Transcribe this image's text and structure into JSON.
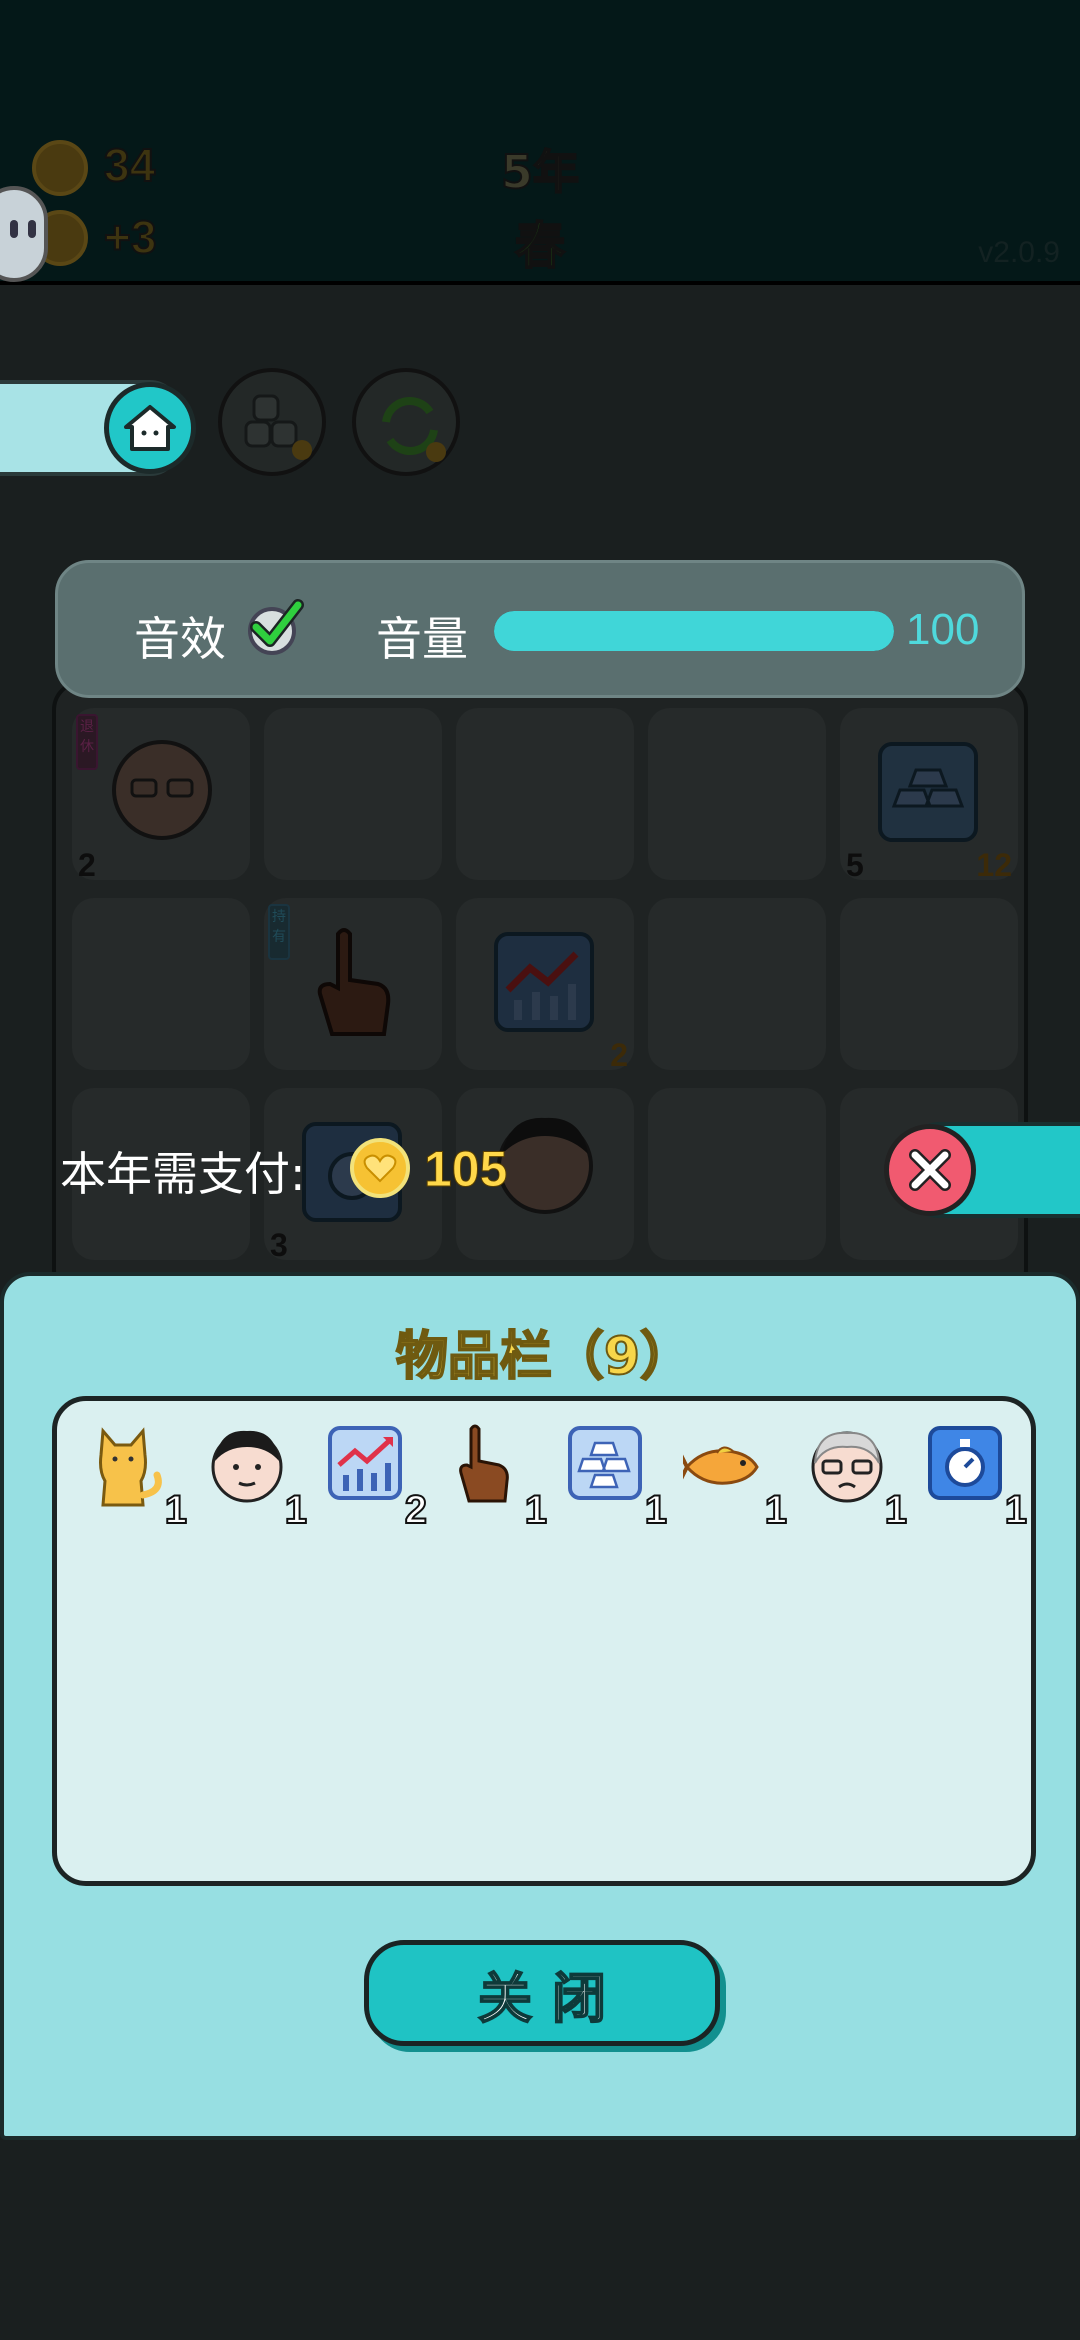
{
  "hud": {
    "coins": "34",
    "income": "+3",
    "year": "5年",
    "season": "春",
    "version": "v2.0.9"
  },
  "board": {
    "tag_retire": "退休",
    "tag_hold": "持有",
    "cells": [
      {
        "item": "old-man-icon",
        "count": "2"
      },
      {
        "item": "gold-bars-icon",
        "count": "5",
        "count2": "12"
      },
      {
        "item": "pointer-hand-icon",
        "count": ""
      },
      {
        "item": "stock-chart-icon",
        "count": "2"
      },
      {
        "item": "stopwatch-icon",
        "count": "3"
      },
      {
        "item": "man-face-icon",
        "count": ""
      }
    ]
  },
  "settings": {
    "sound_label": "音效",
    "sound_on": true,
    "volume_label": "音量",
    "volume_value": "100",
    "volume_fraction": 1.0
  },
  "payment": {
    "label": "本年需支付:",
    "amount": "105"
  },
  "inventory": {
    "title": "物品栏（9）",
    "items": [
      {
        "icon": "cat-icon",
        "count": "1"
      },
      {
        "icon": "man-face-icon",
        "count": "1"
      },
      {
        "icon": "stock-chart-icon",
        "count": "2"
      },
      {
        "icon": "pointer-hand-icon",
        "count": "1"
      },
      {
        "icon": "gold-bars-icon",
        "count": "1"
      },
      {
        "icon": "goldfish-icon",
        "count": "1"
      },
      {
        "icon": "old-man-icon",
        "count": "1"
      },
      {
        "icon": "stopwatch-icon",
        "count": "1"
      }
    ],
    "close_label": "关闭"
  },
  "colors": {
    "accent": "#21c7c8",
    "panel": "#97dfe2",
    "gold": "#f7d64a",
    "danger": "#f15a70"
  }
}
